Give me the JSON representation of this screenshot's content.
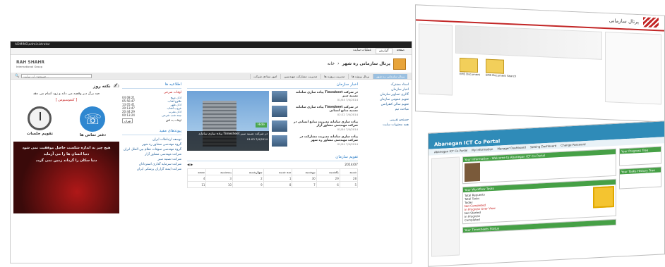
{
  "main": {
    "topbar": {
      "user": "ADMINS\\administrator"
    },
    "ribbon": {
      "tabs": [
        "عملیات سایت",
        "گزارش",
        "صفحه"
      ]
    },
    "header": {
      "title": "پرتال سازمانی ره شهر",
      "breadcrumb": "خانه",
      "org_logo_text": "RAH SHAHR",
      "org_logo_sub": "International Group"
    },
    "nav": {
      "items": [
        "پرتال سازمانی ره شهر",
        "پرتال پروژه ها",
        "مدیریت پروژه ها",
        "مدیریت مشارکت مهندسین",
        "امور ستادی شرکت"
      ],
      "search_placeholder": "جستجوی این سایت..."
    },
    "right_menu": {
      "items": [
        "اسناد مشترک",
        "اخبار سازمان",
        "گالری تصاویر سازمان",
        "تقویم عمومی سازمان",
        "تقویم سالن کنفرانس",
        "مباحث تیم"
      ],
      "other_items": [
        "جستجو تقریبی",
        "همه محتویات سایت"
      ]
    },
    "news": {
      "title": "اخبار سازمان",
      "items": [
        {
          "title": "پیاده سازی سامانه Timesheet در شرکت تصنیه سیر",
          "date": "01/04 7/4/2014"
        },
        {
          "title": "پیاده سازی سامانه Timesheet در شرکت تصنیه منابع انسانی",
          "date": "02:22 7/4/2014"
        },
        {
          "title": "پیاده سازی سامانه مدیریت منابع انسانی در شرکت مهندسی مشاور آزار",
          "date": "01/04 7/4/2014"
        },
        {
          "title": "پیاده سازی سامانه مدیریت مشارکت در شرکت مهندسی مشاور ره شهر",
          "date": "01/04 7/4/2014"
        }
      ],
      "slide_caption": "پیاده سازی سامانه Timesheet در شرکت تصنیه سیر",
      "slide_date": "01:03 7/4/2014",
      "hide_label": "Hide"
    },
    "notices": {
      "title": "اطلاعیه ها",
      "subtitle": "اوقات شرعی",
      "times": [
        "اذان صبح",
        "طلوع آفتاب",
        "اذان ظهر",
        "غروب آفتاب",
        "اذان مغرب",
        "نیمه شب شرعی"
      ],
      "time_values": [
        "04:08:21",
        "05:56:47",
        "13:05:41",
        "20:13:47",
        "20:44:29",
        "00:13:24"
      ],
      "city_label": "اوقات به افق",
      "city_value": "تهران"
    },
    "links": {
      "title": "پیوندهای مفید",
      "items": [
        "توسعه ارتباطات ایران",
        "گروه مهندسی مشاور ره شهر",
        "گروه مهندسی سوقات نظام بین الملل ایران",
        "شرکت مهندسی مشاور آزار",
        "شرکت تصنیه سیر",
        "شرکت سرمایه گذاری استرداتان",
        "شرکت ایمنه گزاران پرشکی ایران"
      ]
    },
    "calendar": {
      "title": "تقویم سازمان",
      "month": "2014/07",
      "days": [
        "شنبه",
        "یکشنبه",
        "دوشنبه",
        "سه شنبه",
        "چهارشنبه",
        "پنجشنبه",
        "جمعه"
      ],
      "row1": [
        "28",
        "29",
        "30",
        "1",
        "2",
        "3",
        "4"
      ],
      "row2": [
        "5",
        "6",
        "7",
        "8",
        "9",
        "10",
        "11"
      ]
    },
    "quote": {
      "title": "نکته روز",
      "text": "صد برگ دیر وقصه می داند و زود اتمام می دهد",
      "author": "[ کنفوسیوس ]"
    },
    "apps": {
      "meetings": "تقویم جلسات",
      "contacts": "دفتر تماس ها"
    },
    "banner": {
      "line1": "هیچ چیز به اندازه شکست حاصل موفقیت نمی شود",
      "line2": "دنیا انسان ها را می آزماید",
      "line3": "دنیا سکان را گرداند زمین نمی گردد"
    }
  },
  "top_right": {
    "title": "پرتال سازمانی",
    "folders": [
      "EMS Document Search",
      "EMS Document"
    ]
  },
  "bottom_right": {
    "title": "Abanegan ICT Co Portal",
    "nav": [
      "Abanegan ICT Co Portal",
      "My Information",
      "Manager Dashboard",
      "Setting Dashboard",
      "Change Password"
    ],
    "panels": [
      "Your Information - Welcome to Abanegan ICT Co Portal",
      "Your Workflow Tasks",
      "Your Timesheets Status",
      "Your Progress Tree",
      "Your Tasks History Tree"
    ],
    "tasks": [
      "Total Requests",
      "Total Tasks",
      "Today",
      "Not Completed",
      "In Progress Over View",
      "Not Started",
      "In Progress",
      "Completed"
    ]
  }
}
